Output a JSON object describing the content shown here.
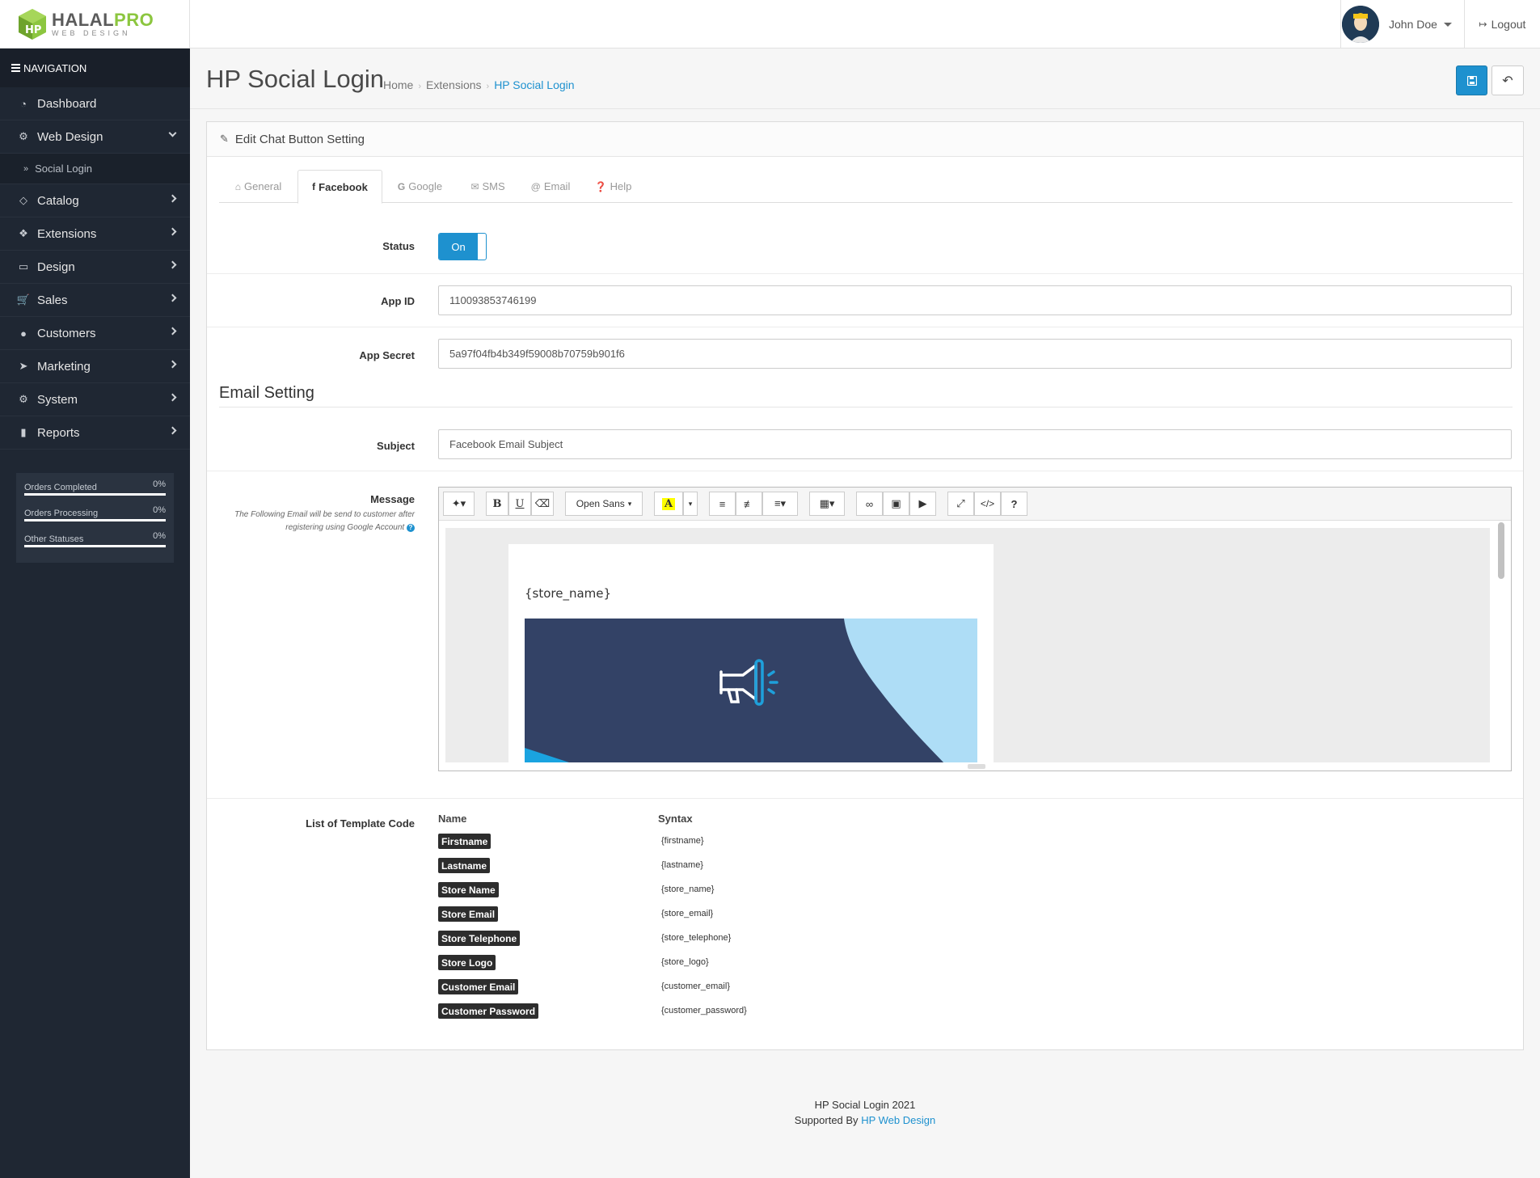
{
  "header": {
    "logo_main": "HALAL",
    "logo_accent": "PRO",
    "logo_sub": "WEB DESIGN",
    "user_name": "John Doe",
    "logout_label": "Logout"
  },
  "sidebar": {
    "title": "NAVIGATION",
    "items": [
      {
        "label": "Dashboard",
        "icon": "dashboard-icon"
      },
      {
        "label": "Web Design",
        "icon": "cogs-icon"
      },
      {
        "label": "Catalog",
        "icon": "tags-icon"
      },
      {
        "label": "Extensions",
        "icon": "puzzle-icon"
      },
      {
        "label": "Design",
        "icon": "monitor-icon"
      },
      {
        "label": "Sales",
        "icon": "cart-icon"
      },
      {
        "label": "Customers",
        "icon": "user-icon"
      },
      {
        "label": "Marketing",
        "icon": "share-icon"
      },
      {
        "label": "System",
        "icon": "gear-icon"
      },
      {
        "label": "Reports",
        "icon": "bar-chart-icon"
      }
    ],
    "sub_item": "Social Login",
    "stats": [
      {
        "label": "Orders Completed",
        "value": "0%"
      },
      {
        "label": "Orders Processing",
        "value": "0%"
      },
      {
        "label": "Other Statuses",
        "value": "0%"
      }
    ]
  },
  "page": {
    "title": "HP Social Login",
    "breadcrumbs": [
      "Home",
      "Extensions",
      "HP Social Login"
    ]
  },
  "panel": {
    "title": "Edit Chat Button Setting",
    "tabs": [
      "General",
      "Facebook",
      "Google",
      "SMS",
      "Email",
      "Help"
    ],
    "active_tab": "Facebook"
  },
  "form": {
    "status_label": "Status",
    "status_value": "On",
    "app_id_label": "App ID",
    "app_id_value": "110093853746199",
    "app_secret_label": "App Secret",
    "app_secret_value": "5a97f04fb4b349f59008b70759b901f6",
    "email_section": "Email Setting",
    "subject_label": "Subject",
    "subject_value": "Facebook Email Subject",
    "message_label": "Message",
    "message_help": "The Following Email will be send to customer after registering using Google Account"
  },
  "editor": {
    "font_name": "Open Sans",
    "content_store_name": "{store_name}"
  },
  "template_codes": {
    "label": "List of Template Code",
    "name_header": "Name",
    "syntax_header": "Syntax",
    "rows": [
      {
        "name": "Firstname",
        "syntax": "{firstname}"
      },
      {
        "name": "Lastname",
        "syntax": "{lastname}"
      },
      {
        "name": "Store Name",
        "syntax": "{store_name}"
      },
      {
        "name": "Store Email",
        "syntax": "{store_email}"
      },
      {
        "name": "Store Telephone",
        "syntax": "{store_telephone}"
      },
      {
        "name": "Store Logo",
        "syntax": "{store_logo}"
      },
      {
        "name": "Customer Email",
        "syntax": "{customer_email}"
      },
      {
        "name": "Customer Password",
        "syntax": "{customer_password}"
      }
    ]
  },
  "footer": {
    "line1": "HP Social Login 2021",
    "line2_prefix": "Supported By",
    "line2_link": "HP Web Design"
  },
  "colors": {
    "accent": "#1e91cf",
    "sidebar": "#1f2733",
    "logo_green": "#8cc63f"
  }
}
